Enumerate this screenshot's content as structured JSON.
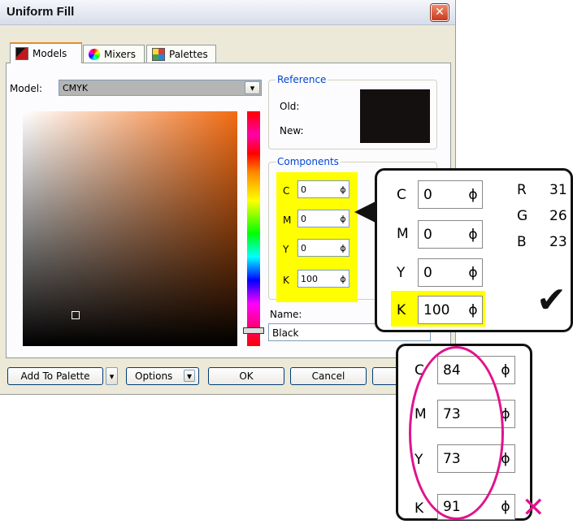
{
  "dialog": {
    "title": "Uniform Fill",
    "close_glyph": "✕",
    "tabs": [
      {
        "label": "Models",
        "icon": "models-icon"
      },
      {
        "label": "Mixers",
        "icon": "mixers-icon"
      },
      {
        "label": "Palettes",
        "icon": "palettes-icon"
      }
    ],
    "model_label": "Model:",
    "model_value": "CMYK",
    "reference": {
      "title": "Reference",
      "old_label": "Old:",
      "new_label": "New:",
      "swatch_color": "#141010"
    },
    "components": {
      "title": "Components",
      "items": [
        {
          "label": "C",
          "value": "0"
        },
        {
          "label": "M",
          "value": "0"
        },
        {
          "label": "Y",
          "value": "0"
        },
        {
          "label": "K",
          "value": "100"
        }
      ],
      "highlight_color": "#ffff00"
    },
    "name_label": "Name:",
    "name_value": "Black",
    "buttons": {
      "add_to_palette": "Add To Palette",
      "options": "Options",
      "ok": "OK",
      "cancel": "Cancel"
    }
  },
  "zoom_good": {
    "cmyk": [
      {
        "label": "C",
        "value": "0"
      },
      {
        "label": "M",
        "value": "0"
      },
      {
        "label": "Y",
        "value": "0"
      },
      {
        "label": "K",
        "value": "100"
      }
    ],
    "rgb": [
      {
        "label": "R",
        "value": "31"
      },
      {
        "label": "G",
        "value": "26"
      },
      {
        "label": "B",
        "value": "23"
      }
    ],
    "mark": "✔"
  },
  "zoom_bad": {
    "cmyk": [
      {
        "label": "C",
        "value": "84"
      },
      {
        "label": "M",
        "value": "73"
      },
      {
        "label": "Y",
        "value": "73"
      },
      {
        "label": "K",
        "value": "91"
      }
    ],
    "mark": "✕",
    "mark_color": "#e0138c"
  },
  "spin_glyph": "ϕ",
  "dropdown_glyph": "▾"
}
